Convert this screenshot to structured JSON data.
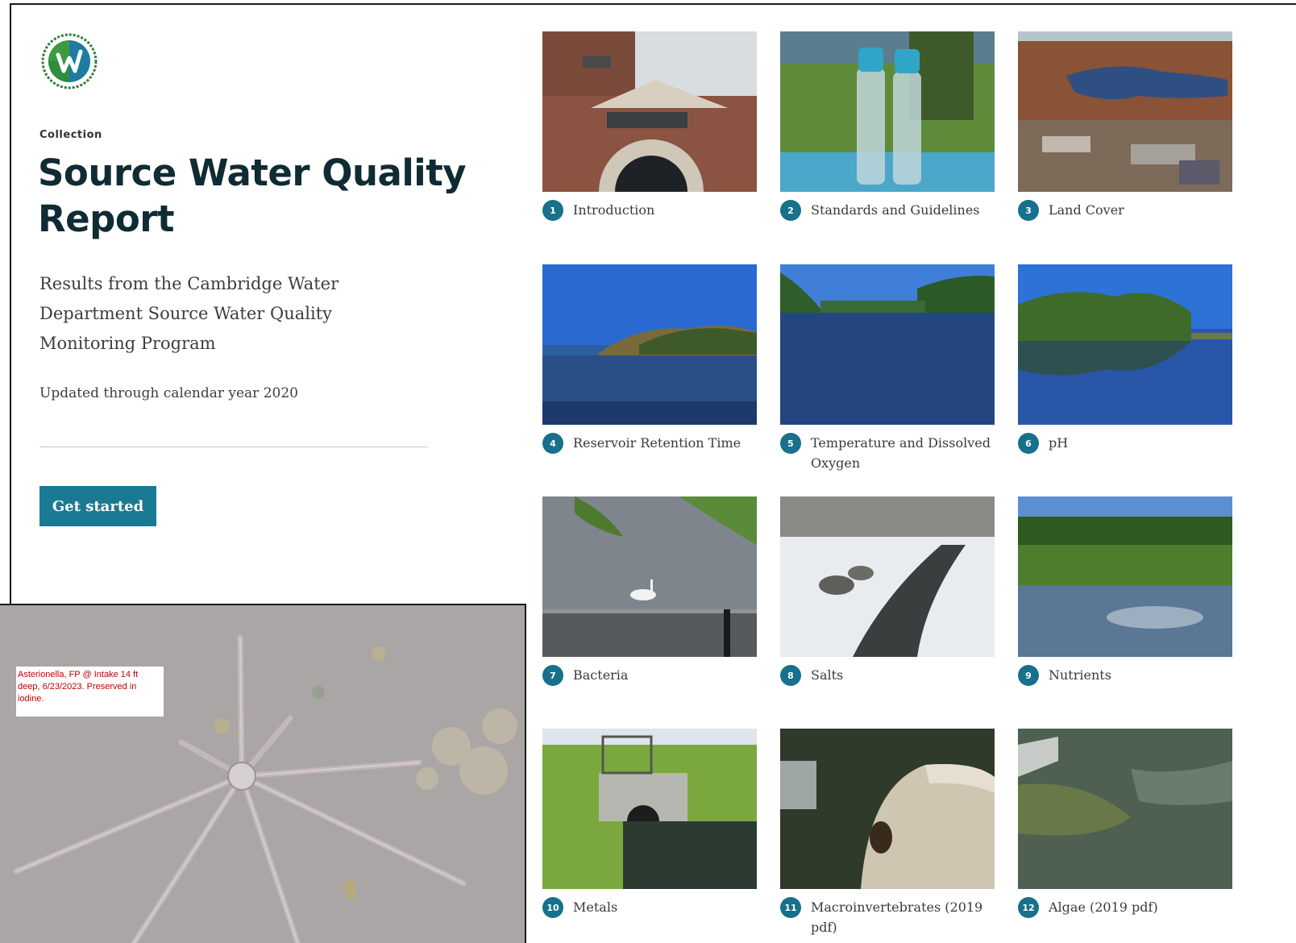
{
  "header": {
    "eyebrow": "Collection",
    "title": "Source Water Quality Report",
    "subtitle": "Results from the Cambridge Water Department Source Water Quality Monitoring Program",
    "updated": "Updated through calendar year 2020",
    "cta_label": "Get started"
  },
  "logo": {
    "icon": "cambridge-water-logo-icon"
  },
  "sections": [
    {
      "num": "1",
      "label": "Introduction",
      "image": "water-treatment-building"
    },
    {
      "num": "2",
      "label": "Standards and Guidelines",
      "image": "water-bottles-on-table"
    },
    {
      "num": "3",
      "label": "Land Cover",
      "image": "aerial-reservoir-view"
    },
    {
      "num": "4",
      "label": "Reservoir Retention Time",
      "image": "reservoir-shoreline"
    },
    {
      "num": "5",
      "label": "Temperature and Dissolved Oxygen",
      "image": "calm-river-reflection"
    },
    {
      "num": "6",
      "label": "pH",
      "image": "wooded-island-reflection"
    },
    {
      "num": "7",
      "label": "Bacteria",
      "image": "swan-behind-fence"
    },
    {
      "num": "8",
      "label": "Salts",
      "image": "snowy-stream"
    },
    {
      "num": "9",
      "label": "Nutrients",
      "image": "lily-pad-pond"
    },
    {
      "num": "10",
      "label": "Metals",
      "image": "culvert-outfall"
    },
    {
      "num": "11",
      "label": "Macroinvertebrates (2019 pdf)",
      "image": "sampling-tray"
    },
    {
      "num": "12",
      "label": "Algae (2019 pdf)",
      "image": "shallow-water-algae"
    }
  ],
  "inset": {
    "note": "Asterionella, FP @ Intake 14 ft deep, 6/23/2023. Preserved in iodine.",
    "image": "asterionella-microscope-photo"
  },
  "colors": {
    "accent": "#1a7a94",
    "badge": "#17708c",
    "title": "#0f2b33",
    "note_text": "#c00000"
  }
}
